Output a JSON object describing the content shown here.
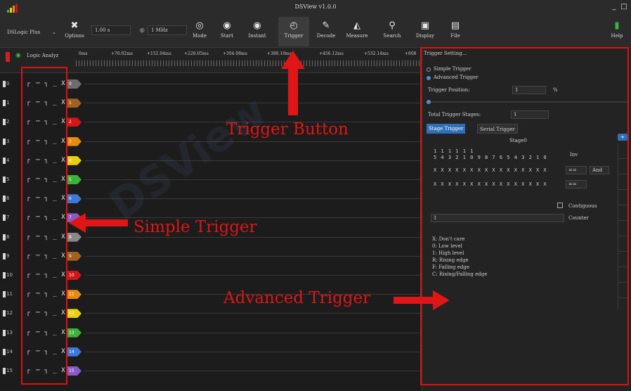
{
  "window": {
    "title": "DSView v1.0.0",
    "minimize": "_",
    "maximize": "□"
  },
  "toolbar": {
    "device": "DSLogic Plus",
    "options_label": "Options",
    "sample_time": "1.00 s",
    "sample_rate": "1 MHz",
    "mode_label": "Mode",
    "start_label": "Start",
    "instant_label": "Instant",
    "trigger_label": "Trigger",
    "decode_label": "Decode",
    "measure_label": "Measure",
    "search_label": "Search",
    "display_label": "Display",
    "file_label": "File",
    "help_label": "Help"
  },
  "ruler": {
    "title": "Logic Analyz",
    "labels": [
      "0ms",
      "+76.02ms",
      "+152.04ms",
      "+228.05ms",
      "+304.08ms",
      "+380.10ms",
      "+456.12ms",
      "+532.14ms",
      "+608"
    ]
  },
  "channels": [
    {
      "index": "0",
      "tag": "0",
      "color": "#6e6e6e"
    },
    {
      "index": "1",
      "tag": "1",
      "color": "#a0621e"
    },
    {
      "index": "2",
      "tag": "2",
      "color": "#d01818"
    },
    {
      "index": "3",
      "tag": "3",
      "color": "#e88a10"
    },
    {
      "index": "4",
      "tag": "4",
      "color": "#e8d010"
    },
    {
      "index": "5",
      "tag": "5",
      "color": "#3cb43c"
    },
    {
      "index": "6",
      "tag": "6",
      "color": "#3c78d8"
    },
    {
      "index": "7",
      "tag": "7",
      "color": "#8a5ac8"
    },
    {
      "index": "8",
      "tag": "8",
      "color": "#888888"
    },
    {
      "index": "9",
      "tag": "9",
      "color": "#a0621e"
    },
    {
      "index": "10",
      "tag": "10",
      "color": "#d01818"
    },
    {
      "index": "11",
      "tag": "11",
      "color": "#e88a10"
    },
    {
      "index": "12",
      "tag": "12",
      "color": "#e8d010"
    },
    {
      "index": "13",
      "tag": "13",
      "color": "#3cb43c"
    },
    {
      "index": "14",
      "tag": "14",
      "color": "#3c78d8"
    },
    {
      "index": "15",
      "tag": "15",
      "color": "#8a5ac8"
    }
  ],
  "trigger_glyphs": [
    "┌",
    "─",
    "┐",
    "_",
    "X"
  ],
  "trigger_panel": {
    "header": "Trigger Setting...",
    "simple_label": "Simple Trigger",
    "advanced_label": "Advanced Trigger",
    "position_label": "Trigger Position:",
    "position_value": "1",
    "position_unit": "%",
    "stages_label": "Total Trigger Stages:",
    "stages_value": "1",
    "tab_stage": "Stage Trigger",
    "tab_serial": "Serial Trigger",
    "stage_name": "Stage0",
    "bit_row1": "1 1 1 1 1 1",
    "bit_row2": "5 4 3 2 1 0 9 8 7 6 5 4 3 2 1 0",
    "pattern_row1": "X X X X X X X X X X X X X X X X",
    "pattern_row2": "X X X X X X X X X X X X X X X X",
    "inv_label": "Inv",
    "op1": "==",
    "logic": "And",
    "op2": "==",
    "contiguous_label": "Contiguous",
    "counter_value": "1",
    "counter_label": "Counter",
    "legend": [
      "X: Don't care",
      "0: Low level",
      "1: High level",
      "R: Rising edge",
      "F: Falling edge",
      "C: Rising/Falling edge"
    ]
  },
  "annotations": {
    "trigger_button": "Trigger Button",
    "simple_trigger": "Simple Trigger",
    "advanced_trigger": "Advanced Trigger",
    "color": "#e01515"
  }
}
